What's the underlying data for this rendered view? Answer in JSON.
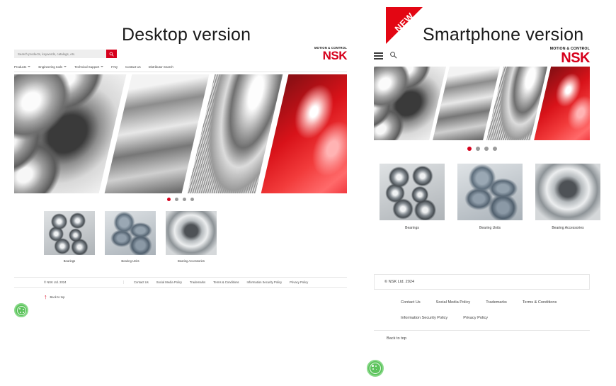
{
  "headings": {
    "desktop": "Desktop version",
    "smartphone": "Smartphone version"
  },
  "badge": {
    "label": "NEW",
    "color": "#e30613"
  },
  "brand": {
    "tagline": "MOTION & CONTROL",
    "name": "NSK",
    "color": "#d6001c"
  },
  "desktop": {
    "search": {
      "placeholder": "Search products, keywords, catalogs, etc.",
      "value": "",
      "button_color": "#d6001c",
      "icon": "search-icon"
    },
    "nav": [
      {
        "label": "Products",
        "has_caret": true
      },
      {
        "label": "Engineering tools",
        "has_caret": true
      },
      {
        "label": "Technical Support",
        "has_caret": true
      },
      {
        "label": "FAQ",
        "has_caret": false
      },
      {
        "label": "Contact Us",
        "has_caret": false
      },
      {
        "label": "Distributor Search",
        "has_caret": false
      }
    ],
    "carousel": {
      "total": 4,
      "active_index": 0,
      "active_color": "#d6001c",
      "inactive_color": "#9b9b9b"
    },
    "products": [
      {
        "label": "Bearings"
      },
      {
        "label": "Bearing Units"
      },
      {
        "label": "Bearing Accessories"
      }
    ],
    "footer": {
      "copyright": "© NSK Ltd. 2024",
      "links": [
        "Contact Us",
        "Social Media Policy",
        "Trademarks",
        "Terms & Conditions",
        "Information Security Policy",
        "Privacy Policy"
      ],
      "back_to_top": "Back to top",
      "back_to_top_arrow": "↑",
      "arrow_color": "#d6001c",
      "cookie_icon": "cookie-settings-icon",
      "cookie_color": "#5cc35c"
    }
  },
  "smartphone": {
    "menu_icon": "hamburger-menu-icon",
    "search_icon": "search-icon",
    "carousel": {
      "total": 4,
      "active_index": 0,
      "active_color": "#d6001c",
      "inactive_color": "#9b9b9b"
    },
    "products": [
      {
        "label": "Bearings"
      },
      {
        "label": "Bearing Units"
      },
      {
        "label": "Bearing Accessories"
      }
    ],
    "footer": {
      "copyright": "© NSK Ltd. 2024",
      "links_row1": [
        "Contact Us",
        "Social Media Policy",
        "Trademarks",
        "Terms & Conditions"
      ],
      "links_row2": [
        "Information Security Policy",
        "Privacy Policy"
      ],
      "back_to_top": "Back to top",
      "cookie_icon": "cookie-settings-icon",
      "cookie_color": "#5cc35c"
    }
  }
}
